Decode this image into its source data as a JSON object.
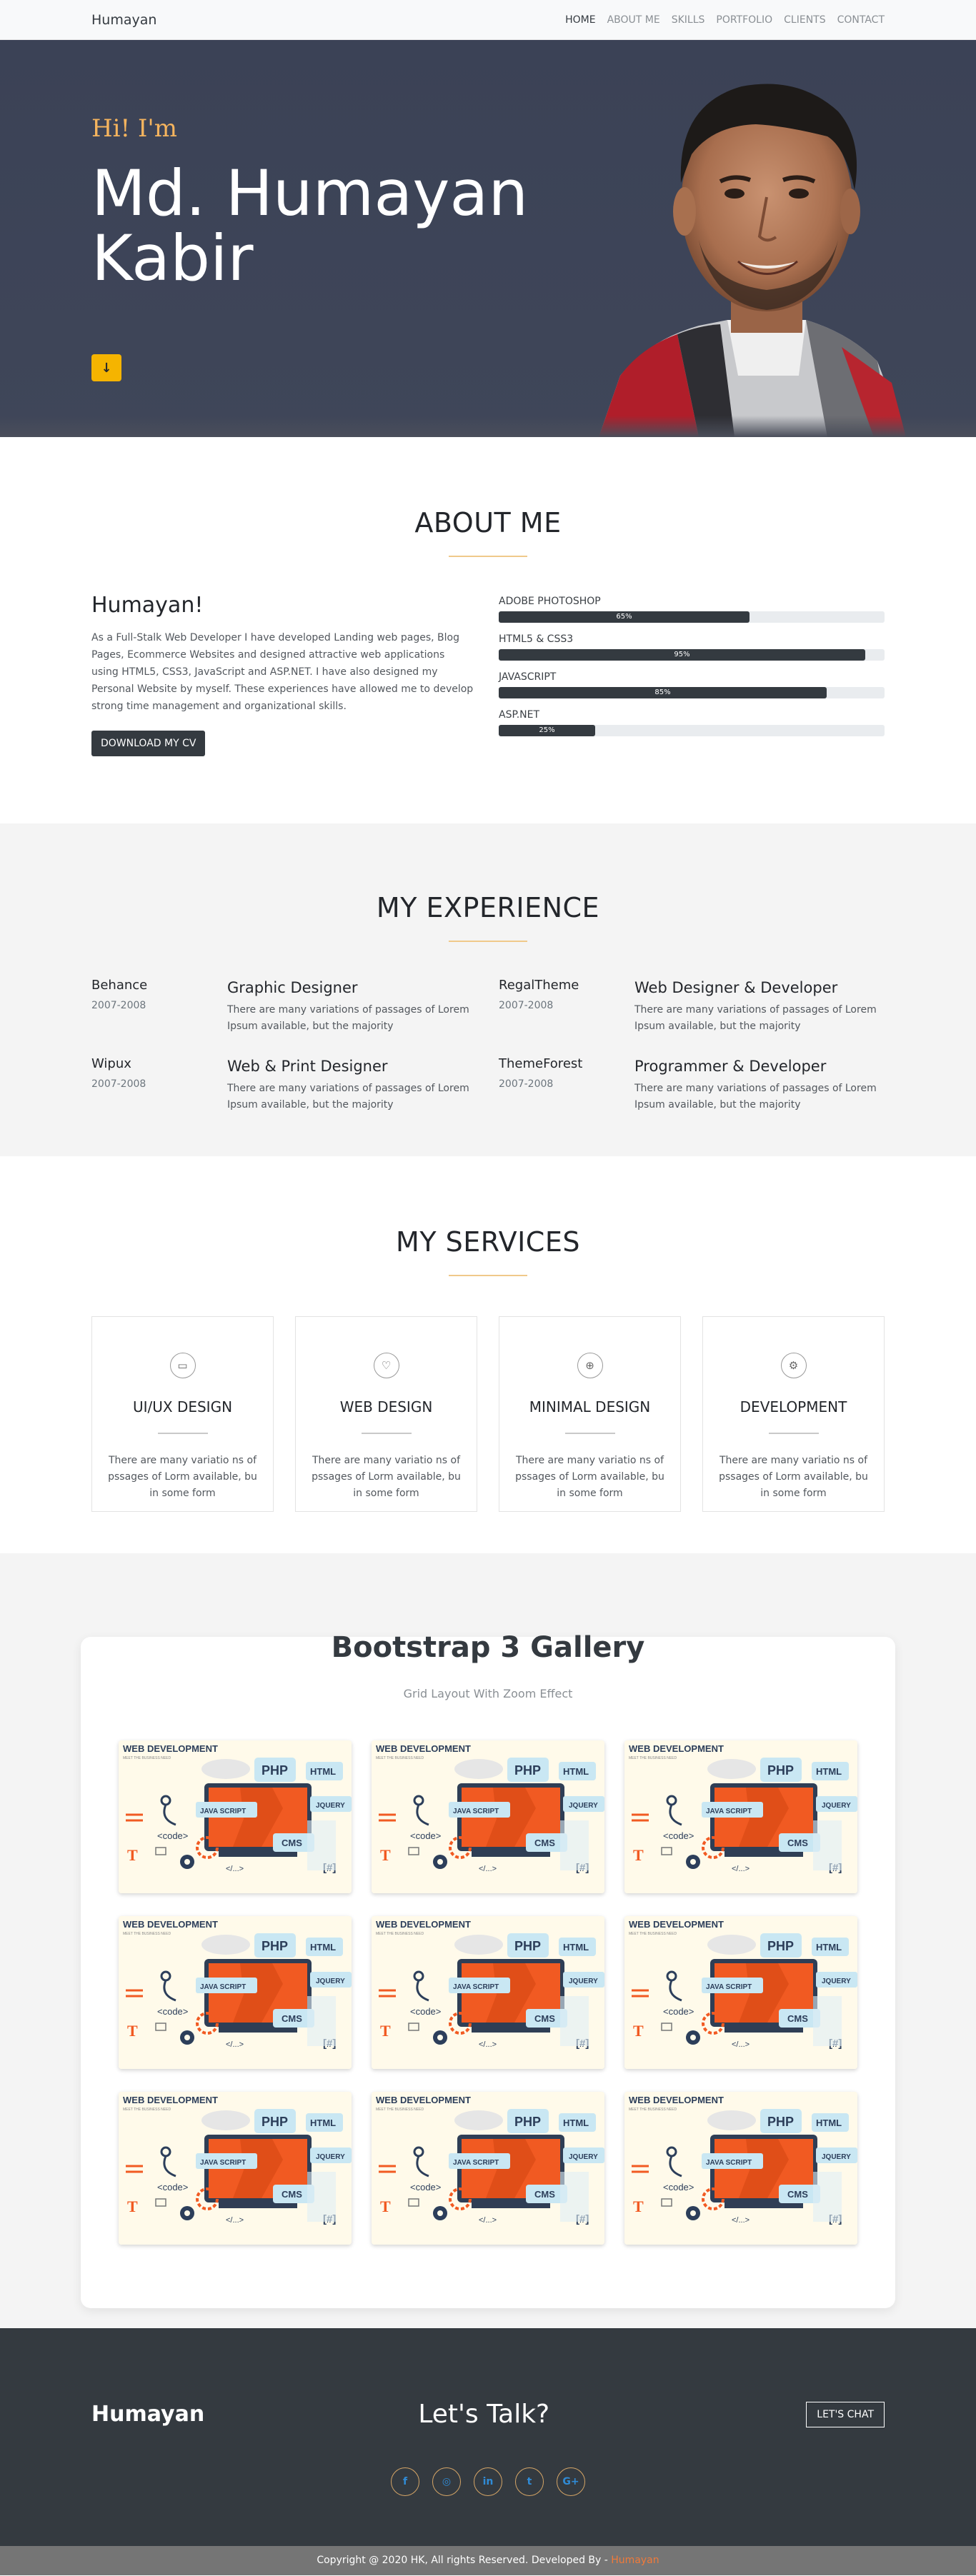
{
  "nav": {
    "brand": "Humayan",
    "items": [
      "HOME",
      "ABOUT ME",
      "SKILLS",
      "PORTFOLIO",
      "CLIENTS",
      "CONTACT"
    ],
    "active": "HOME"
  },
  "hero": {
    "greeting": "Hi! I'm",
    "name": "Md. Humayan Kabir",
    "scroll_icon": "arrow-down-icon"
  },
  "about": {
    "title": "ABOUT ME",
    "heading": "Humayan!",
    "text": "As a Full-Stalk Web Developer I have developed Landing web pages, Blog Pages, Ecommerce Websites and designed attractive web applications using HTML5, CSS3, JavaScript and ASP.NET. I have also designed my Personal Website by myself. These experiences have allowed me to develop strong time management and organizational skills.",
    "cv_button": "DOWNLOAD MY CV",
    "skills": [
      {
        "name": "ADOBE PHOTOSHOP",
        "label": "65%",
        "value": 65
      },
      {
        "name": "HTML5 & CSS3",
        "label": "95%",
        "value": 95
      },
      {
        "name": "JAVASCRIPT",
        "label": "85%",
        "value": 85
      },
      {
        "name": "ASP.NET",
        "label": "25%",
        "value": 25
      }
    ]
  },
  "experience": {
    "title": "MY EXPERIENCE",
    "items": [
      {
        "company": "Behance",
        "years": "2007-2008",
        "role": "Graphic Designer",
        "desc": "There are many variations of passages of Lorem Ipsum available, but the majority"
      },
      {
        "company": "RegalTheme",
        "years": "2007-2008",
        "role": "Web Designer & Developer",
        "desc": "There are many variations of passages of Lorem Ipsum available, but the majority"
      },
      {
        "company": "Wipux",
        "years": "2007-2008",
        "role": "Web & Print Designer",
        "desc": "There are many variations of passages of Lorem Ipsum available, but the majority"
      },
      {
        "company": "ThemeForest",
        "years": "2007-2008",
        "role": "Programmer & Developer",
        "desc": "There are many variations of passages of Lorem Ipsum available, but the majority"
      }
    ]
  },
  "services": {
    "title": "MY SERVICES",
    "items": [
      {
        "title": "UI/UX DESIGN",
        "icon": "desktop-icon",
        "glyph": "▭",
        "desc": "There are many variatio ns of pssages of Lorm available, bu in some form"
      },
      {
        "title": "WEB DESIGN",
        "icon": "heart-icon",
        "glyph": "♡",
        "desc": "There are many variatio ns of pssages of Lorm available, bu in some form"
      },
      {
        "title": "MINIMAL DESIGN",
        "icon": "crosshair-icon",
        "glyph": "⊕",
        "desc": "There are many variatio ns of pssages of Lorm available, bu in some form"
      },
      {
        "title": "DEVELOPMENT",
        "icon": "gear-icon",
        "glyph": "⚙",
        "desc": "There are many variatio ns of pssages of Lorm available, bu in some form"
      }
    ]
  },
  "gallery": {
    "title": "Bootstrap 3 Gallery",
    "subtitle": "Grid Layout With Zoom Effect",
    "image_heading": "WEB DEVELOPMENT",
    "image_tagline": "MEET THE BUSINESS NEED",
    "image_labels": [
      "PHP",
      "HTML",
      "JAVA SCRIPT",
      "JQUERY",
      "<code>",
      "CMS",
      "</...>",
      "[#]",
      "T"
    ]
  },
  "footer": {
    "brand": "Humayan",
    "talk": "Let's Talk?",
    "chat_button": "LET'S CHAT",
    "socials": [
      {
        "name": "facebook-icon",
        "glyph": "f"
      },
      {
        "name": "instagram-icon",
        "glyph": "◎"
      },
      {
        "name": "linkedin-icon",
        "glyph": "in"
      },
      {
        "name": "twitter-icon",
        "glyph": "t"
      },
      {
        "name": "google-plus-icon",
        "glyph": "G+"
      }
    ],
    "copyright": "Copyright @ 2020 HK, All rights Reserved. Developed By - ",
    "developer": "Humayan"
  },
  "colors": {
    "accent": "#f5b400",
    "dark": "#343a40",
    "hero_bg": "#3d4458",
    "orange": "#f07a3a"
  }
}
